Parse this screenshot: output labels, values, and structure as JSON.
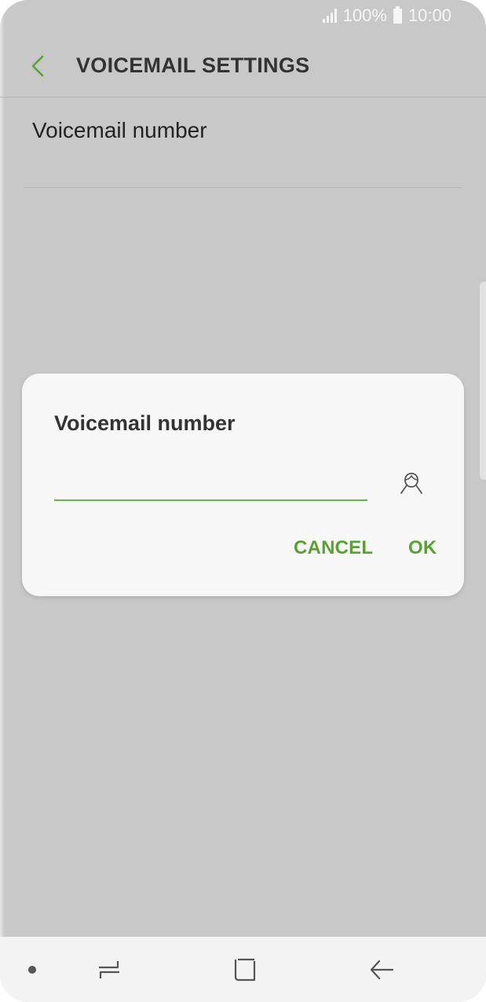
{
  "status_bar": {
    "battery": "100%",
    "time": "10:00"
  },
  "app_bar": {
    "title": "VOICEMAIL SETTINGS"
  },
  "settings": {
    "items": [
      {
        "label": "Voicemail number"
      }
    ]
  },
  "dialog": {
    "title": "Voicemail number",
    "input_value": "",
    "cancel_label": "CANCEL",
    "ok_label": "OK"
  },
  "icons": {
    "back": "back-arrow-icon",
    "contact": "contact-person-icon",
    "recent_apps": "recent-apps-icon",
    "home": "home-icon",
    "back_nav": "back-nav-icon"
  },
  "colors": {
    "accent": "#5aa135",
    "input_underline": "#6ab04c",
    "background_dim": "#c8c8c8",
    "dialog_bg": "#f7f7f7"
  }
}
